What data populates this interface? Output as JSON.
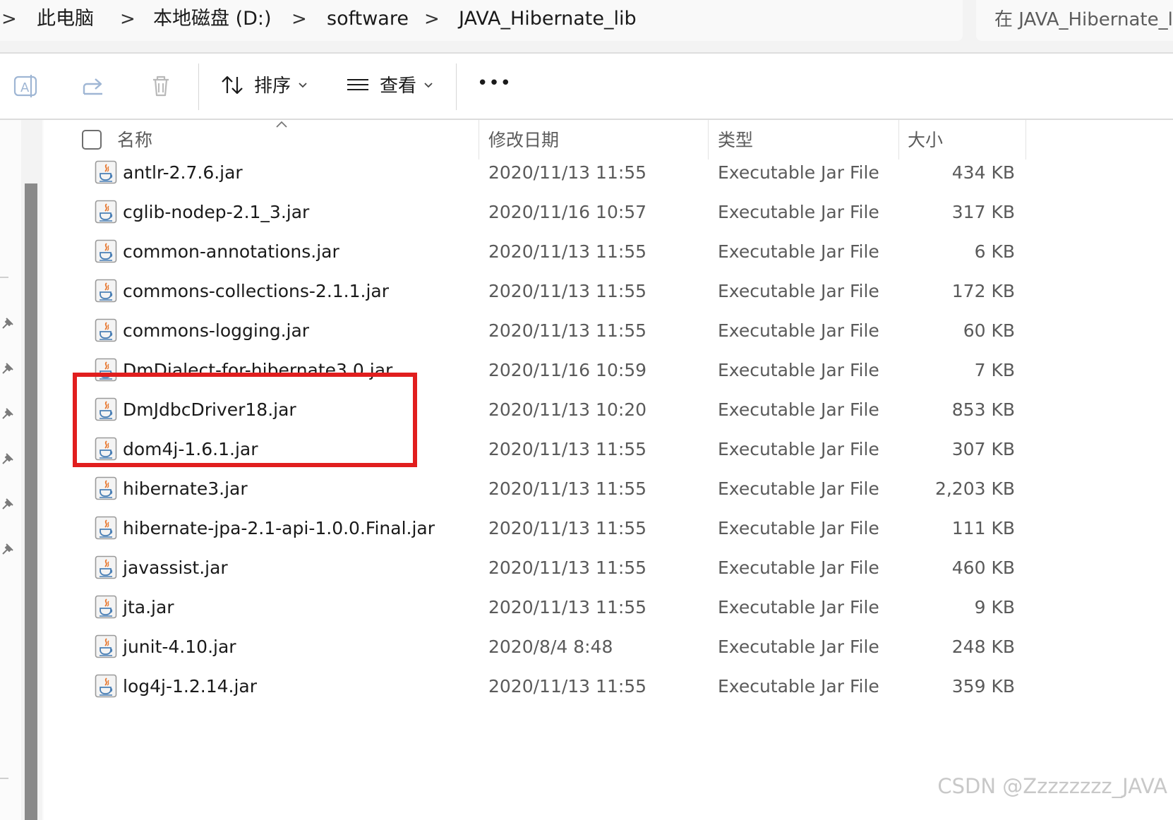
{
  "address_bar": {
    "crumbs": [
      "此电脑",
      "本地磁盘 (D:)",
      "software",
      "JAVA_Hibernate_lib"
    ],
    "separator": ">"
  },
  "search": {
    "placeholder": "在 JAVA_Hibernate_li"
  },
  "toolbar": {
    "icons": [
      "rename-icon",
      "share-icon",
      "delete-icon"
    ],
    "sort_label": "排序",
    "view_label": "查看",
    "more_label": "•••"
  },
  "columns": {
    "name": "名称",
    "modified": "修改日期",
    "type": "类型",
    "size": "大小"
  },
  "files": [
    {
      "name": "antlr-2.7.6.jar",
      "modified": "2020/11/13 11:55",
      "type": "Executable Jar File",
      "size": "434 KB"
    },
    {
      "name": "cglib-nodep-2.1_3.jar",
      "modified": "2020/11/16 10:57",
      "type": "Executable Jar File",
      "size": "317 KB"
    },
    {
      "name": "common-annotations.jar",
      "modified": "2020/11/13 11:55",
      "type": "Executable Jar File",
      "size": "6 KB"
    },
    {
      "name": "commons-collections-2.1.1.jar",
      "modified": "2020/11/13 11:55",
      "type": "Executable Jar File",
      "size": "172 KB"
    },
    {
      "name": "commons-logging.jar",
      "modified": "2020/11/13 11:55",
      "type": "Executable Jar File",
      "size": "60 KB"
    },
    {
      "name": "DmDialect-for-hibernate3.0.jar",
      "modified": "2020/11/16 10:59",
      "type": "Executable Jar File",
      "size": "7 KB"
    },
    {
      "name": "DmJdbcDriver18.jar",
      "modified": "2020/11/13 10:20",
      "type": "Executable Jar File",
      "size": "853 KB"
    },
    {
      "name": "dom4j-1.6.1.jar",
      "modified": "2020/11/13 11:55",
      "type": "Executable Jar File",
      "size": "307 KB"
    },
    {
      "name": "hibernate3.jar",
      "modified": "2020/11/13 11:55",
      "type": "Executable Jar File",
      "size": "2,203 KB"
    },
    {
      "name": "hibernate-jpa-2.1-api-1.0.0.Final.jar",
      "modified": "2020/11/13 11:55",
      "type": "Executable Jar File",
      "size": "111 KB"
    },
    {
      "name": "javassist.jar",
      "modified": "2020/11/13 11:55",
      "type": "Executable Jar File",
      "size": "460 KB"
    },
    {
      "name": "jta.jar",
      "modified": "2020/11/13 11:55",
      "type": "Executable Jar File",
      "size": "9 KB"
    },
    {
      "name": "junit-4.10.jar",
      "modified": "2020/8/4 8:48",
      "type": "Executable Jar File",
      "size": "248 KB"
    },
    {
      "name": "log4j-1.2.14.jar",
      "modified": "2020/11/13 11:55",
      "type": "Executable Jar File",
      "size": "359 KB"
    }
  ],
  "watermark": "CSDN @Zzzzzzzz_JAVA",
  "colors": {
    "highlight": "#e11e1e",
    "jar_icon_flame": "#e8772e",
    "jar_icon_cup": "#4a7fb5"
  }
}
